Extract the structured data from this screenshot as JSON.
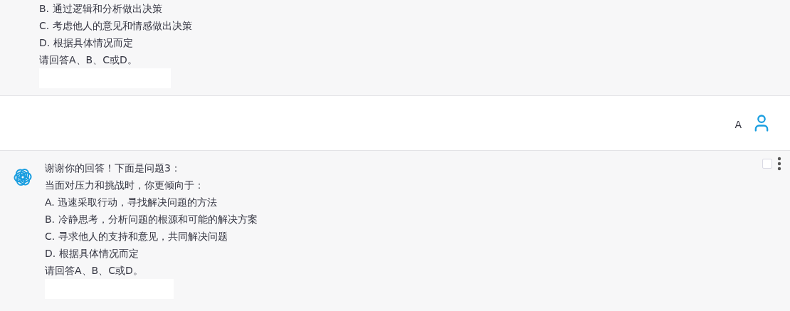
{
  "messages": [
    {
      "kind": "assistant",
      "show_avatar": false,
      "lines": [
        "B. 通过逻辑和分析做出决策",
        "C. 考虑他人的意见和情感做出决策",
        "D. 根据具体情况而定",
        "请回答A、B、C或D。"
      ]
    },
    {
      "kind": "user",
      "text": "A"
    },
    {
      "kind": "assistant",
      "show_avatar": true,
      "checked": false,
      "lines": [
        "谢谢你的回答！下面是问题3：",
        "当面对压力和挑战时，你更倾向于：",
        "A. 迅速采取行动，寻找解决问题的方法",
        "B. 冷静思考，分析问题的根源和可能的解决方案",
        "C. 寻求他人的支持和意见，共同解决问题",
        "D. 根据具体情况而定",
        "请回答A、B、C或D。"
      ]
    }
  ]
}
